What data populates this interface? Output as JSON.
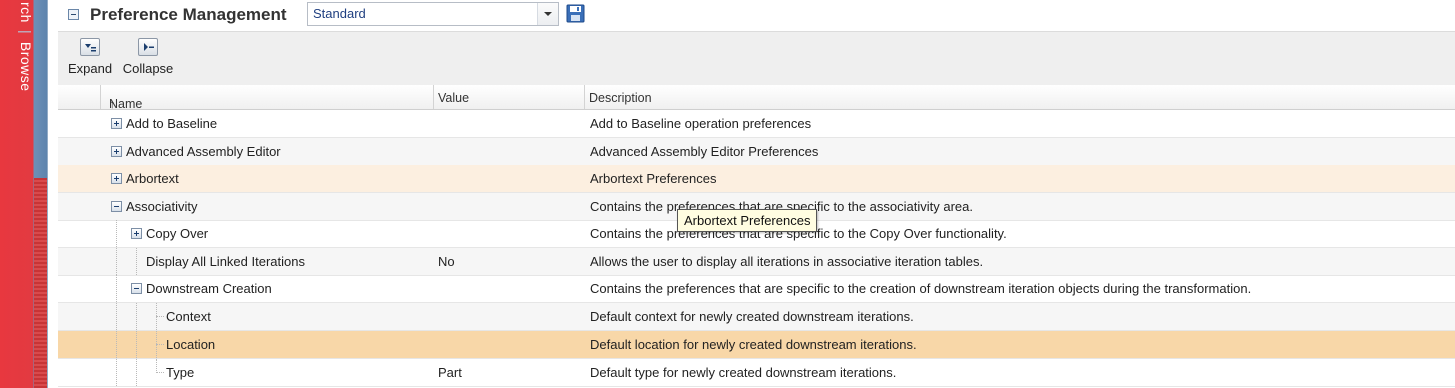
{
  "sidebar": {
    "search_label": "rch",
    "separator": "|",
    "browse_label": "Browse"
  },
  "header": {
    "title": "Preference Management",
    "profile_value": "Standard"
  },
  "toolbar": {
    "expand_label": "Expand",
    "collapse_label": "Collapse"
  },
  "grid": {
    "columns": {
      "name": "Name",
      "sort_indicator": "↑",
      "value": "Value",
      "description": "Description"
    },
    "rows": [
      {
        "name": "Add to Baseline",
        "value": "",
        "description": "Add to Baseline operation preferences"
      },
      {
        "name": "Advanced Assembly Editor",
        "value": "",
        "description": "Advanced Assembly Editor Preferences"
      },
      {
        "name": "Arbortext",
        "value": "",
        "description": "Arbortext Preferences"
      },
      {
        "name": "Associativity",
        "value": "",
        "description": "Contains the preferences that are specific to the associativity area."
      },
      {
        "name": "Copy Over",
        "value": "",
        "description": "Contains the preferences that are specific to the Copy Over functionality."
      },
      {
        "name": "Display All Linked Iterations",
        "value": "No",
        "description": "Allows the user to display all iterations in associative iteration tables."
      },
      {
        "name": "Downstream Creation",
        "value": "",
        "description": "Contains the preferences that are specific to the creation of downstream iteration objects during the transformation."
      },
      {
        "name": "Context",
        "value": "",
        "description": "Default context for newly created downstream iterations."
      },
      {
        "name": "Location",
        "value": "",
        "description": "Default location for newly created downstream iterations."
      },
      {
        "name": "Type",
        "value": "Part",
        "description": "Default type for newly created downstream iterations."
      }
    ]
  },
  "tooltip": {
    "text": "Arbortext Preferences"
  },
  "colors": {
    "row_hover": "#fcefe0",
    "row_selected": "#f8d7a8",
    "link_blue": "#1f3f80",
    "sidebar_red": "#e8383f"
  }
}
